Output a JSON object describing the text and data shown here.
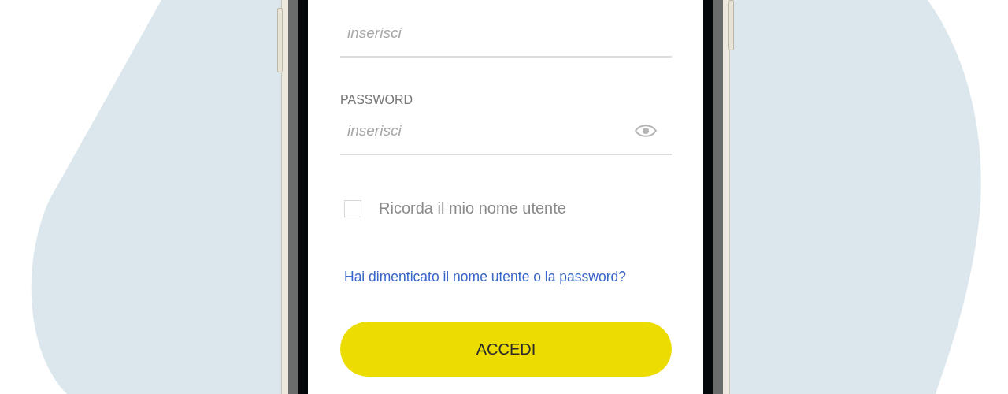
{
  "fields": [
    {
      "kind": "text",
      "placeholder": "inserisci"
    },
    {
      "kind": "password",
      "label": "PASSWORD",
      "placeholder": "inserisci"
    }
  ],
  "remember": {
    "label": "Ricorda il mio nome utente",
    "checked": false
  },
  "forgot_link": "Hai dimenticato il nome utente o la password?",
  "submit_button": "ACCEDI"
}
